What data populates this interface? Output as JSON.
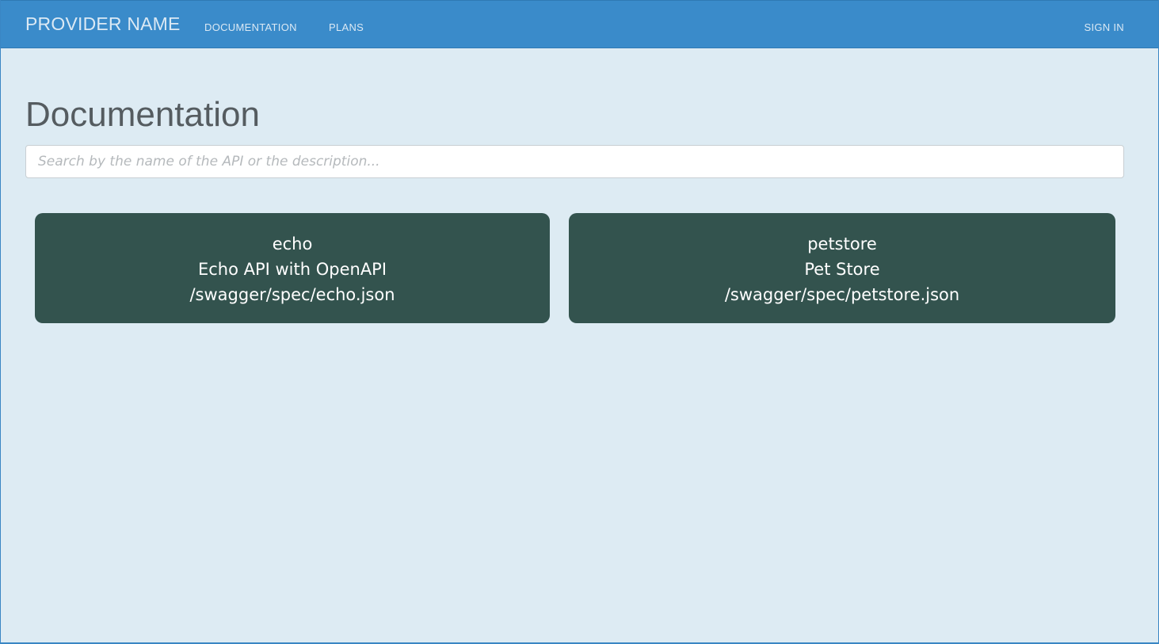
{
  "navbar": {
    "brand": "PROVIDER NAME",
    "links": [
      {
        "label": "DOCUMENTATION"
      },
      {
        "label": "PLANS"
      }
    ],
    "signin_label": "SIGN IN"
  },
  "main": {
    "title": "Documentation",
    "search": {
      "placeholder": "Search by the name of the API or the description...",
      "value": ""
    },
    "apis": [
      {
        "name": "echo",
        "description": "Echo API with OpenAPI",
        "spec_path": "/swagger/spec/echo.json"
      },
      {
        "name": "petstore",
        "description": "Pet Store",
        "spec_path": "/swagger/spec/petstore.json"
      }
    ]
  },
  "colors": {
    "navbar_bg": "#3a8bca",
    "page_bg": "#ddebf3",
    "card_bg": "#33534e",
    "title_text": "#555c60"
  }
}
